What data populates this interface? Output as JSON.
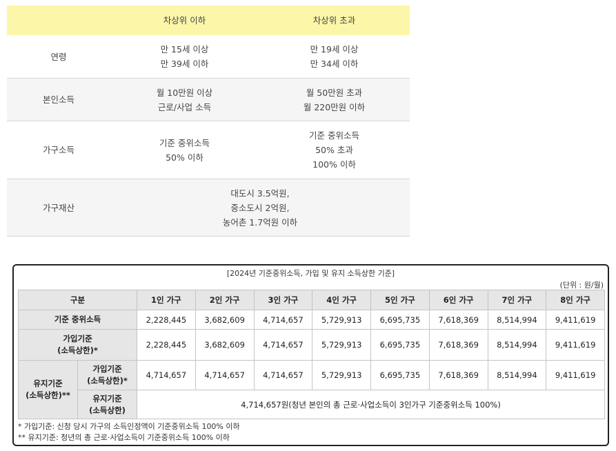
{
  "top_table": {
    "headers": [
      "",
      "차상위 이하",
      "차상위 초과"
    ],
    "rows": {
      "age": {
        "label": "연령",
        "below": [
          "만 15세 이상",
          "만 39세 이하"
        ],
        "above": [
          "만 19세 이상",
          "만 34세 이하"
        ]
      },
      "income": {
        "label": "본인소득",
        "below": [
          "월 10만원 이상",
          "근로/사업 소득"
        ],
        "above": [
          "월 50만원 초과",
          "월 220만원 이하"
        ]
      },
      "household": {
        "label": "가구소득",
        "below": [
          "기준 중위소득",
          "50% 이하"
        ],
        "above": [
          "기준 중위소득",
          "50% 초과",
          "100% 이하"
        ]
      },
      "assets": {
        "label": "가구재산",
        "value": [
          "대도시 3.5억원,",
          "중소도시 2억원,",
          "농어촌 1.7억원 이하"
        ]
      }
    }
  },
  "std_table": {
    "caption": "[2024년 기준중위소득, 가입 및 유지 소득상한 기준]",
    "unit": "(단위 : 원/월)",
    "col_header": "구분",
    "household_sizes": [
      "1인 가구",
      "2인 가구",
      "3인 가구",
      "4인 가구",
      "5인 가구",
      "6인 가구",
      "7인 가구",
      "8인 가구"
    ],
    "median": {
      "label": "기준 중위소득",
      "values": [
        "2,228,445",
        "3,682,609",
        "4,714,657",
        "5,729,913",
        "6,695,735",
        "7,618,369",
        "8,514,994",
        "9,411,619"
      ]
    },
    "join": {
      "label_1": "가입기준",
      "label_2": "(소득상한)*",
      "values": [
        "2,228,445",
        "3,682,609",
        "4,714,657",
        "5,729,913",
        "6,695,735",
        "7,618,369",
        "8,514,994",
        "9,411,619"
      ]
    },
    "keep": {
      "label_1": "유지기준",
      "label_2": "(소득상한)**",
      "sub1_label_1": "가입기준",
      "sub1_label_2": "(소득상한)*",
      "sub1_values": [
        "4,714,657",
        "4,714,657",
        "4,714,657",
        "5,729,913",
        "6,695,735",
        "7,618,369",
        "8,514,994",
        "9,411,619"
      ],
      "sub2_label_1": "유지기준",
      "sub2_label_2": "(소득상한)",
      "sub2_value": "4,714,657원(청년 본인의 총 근로·사업소득이 3인가구 기준중위소득 100%)"
    },
    "notes": [
      "* 가입기준: 신청 당시 가구의 소득인정액이 기준중위소득 100% 이하",
      "** 유지기준: 청년의 총 근로·사업소득이 기준중위소득 100% 이하"
    ]
  }
}
